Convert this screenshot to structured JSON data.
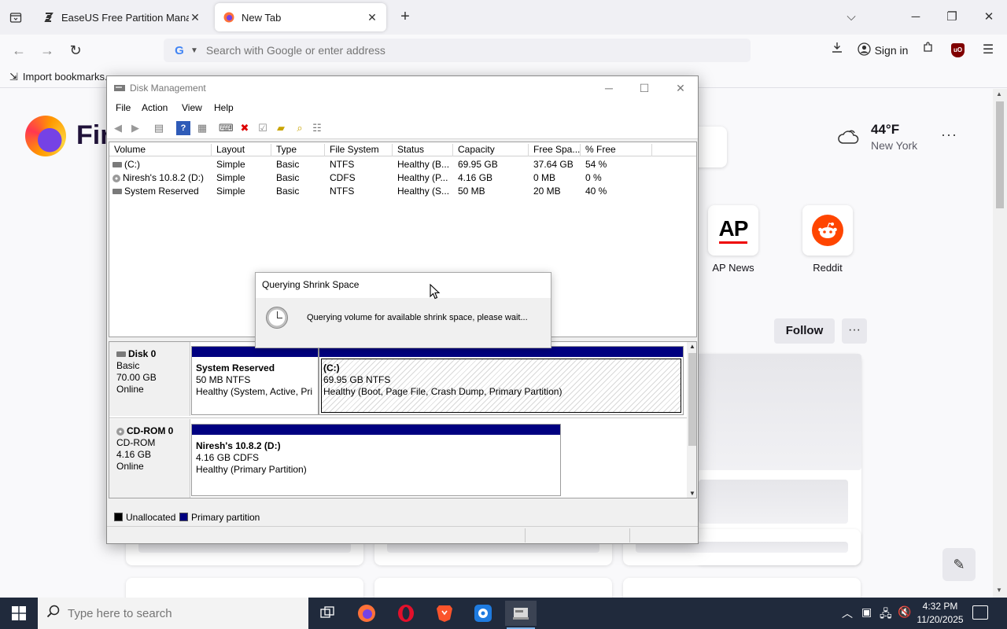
{
  "browser": {
    "tabs": [
      {
        "title": "EaseUS Free Partition Manager |",
        "active": false
      },
      {
        "title": "New Tab",
        "active": true
      }
    ],
    "address_placeholder": "Search with Google or enter address",
    "search_engine_icon": "G",
    "sign_in_label": "Sign in",
    "bookmark_import_label": "Import bookmarks...",
    "brand_wordmark": "Fir"
  },
  "newtab": {
    "weather": {
      "temp": "44°F",
      "city": "New York"
    },
    "shortcuts": [
      {
        "label": "AP News",
        "logo": "AP"
      },
      {
        "label": "Reddit",
        "logo": "reddit-icon"
      }
    ],
    "follow_label": "Follow"
  },
  "disk_mgmt": {
    "title": "Disk Management",
    "menu": [
      "File",
      "Action",
      "View",
      "Help"
    ],
    "columns": [
      "Volume",
      "Layout",
      "Type",
      "File System",
      "Status",
      "Capacity",
      "Free Spa...",
      "% Free"
    ],
    "volumes": [
      {
        "volume": "(C:)",
        "layout": "Simple",
        "type": "Basic",
        "fs": "NTFS",
        "status": "Healthy (B...",
        "capacity": "69.95 GB",
        "free": "37.64 GB",
        "pct": "54 %",
        "icon": "drive-icon"
      },
      {
        "volume": "Niresh's 10.8.2 (D:)",
        "layout": "Simple",
        "type": "Basic",
        "fs": "CDFS",
        "status": "Healthy (P...",
        "capacity": "4.16 GB",
        "free": "0 MB",
        "pct": "0 %",
        "icon": "cd-icon"
      },
      {
        "volume": "System Reserved",
        "layout": "Simple",
        "type": "Basic",
        "fs": "NTFS",
        "status": "Healthy (S...",
        "capacity": "50 MB",
        "free": "20 MB",
        "pct": "40 %",
        "icon": "drive-icon"
      }
    ],
    "disks": [
      {
        "name": "Disk 0",
        "kind": "Basic",
        "size": "70.00 GB",
        "state": "Online",
        "partitions": [
          {
            "name": "System Reserved",
            "size": "50 MB NTFS",
            "status": "Healthy (System, Active, Pri"
          },
          {
            "name": "(C:)",
            "size": "69.95 GB NTFS",
            "status": "Healthy (Boot, Page File, Crash Dump, Primary Partition)"
          }
        ]
      },
      {
        "name": "CD-ROM 0",
        "kind": "CD-ROM",
        "size": "4.16 GB",
        "state": "Online",
        "partitions": [
          {
            "name": "Niresh's 10.8.2  (D:)",
            "size": "4.16 GB CDFS",
            "status": "Healthy (Primary Partition)"
          }
        ]
      }
    ],
    "legend": [
      {
        "label": "Unallocated",
        "color": "#000000"
      },
      {
        "label": "Primary partition",
        "color": "#000080"
      }
    ],
    "dialog": {
      "title": "Querying Shrink Space",
      "message": "Querying volume for available shrink space, please wait..."
    }
  },
  "taskbar": {
    "search_placeholder": "Type here to search",
    "time": "4:32 PM",
    "date": "11/20/2025"
  }
}
